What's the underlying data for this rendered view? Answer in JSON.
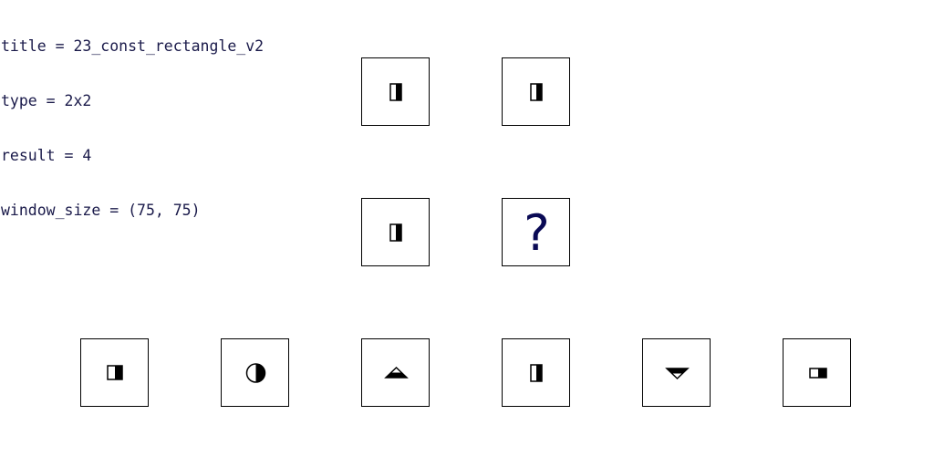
{
  "header": {
    "title_line": "title = 23_const_rectangle_v2",
    "type_line": "type = 2x2",
    "result_line": "result = 4",
    "window_line": "window_size = (75, 75)"
  },
  "matrix": {
    "cells": [
      {
        "shape": "half-filled-vertical-rect-icon",
        "fill_side": "right"
      },
      {
        "shape": "half-filled-vertical-rect-icon",
        "fill_side": "right"
      },
      {
        "shape": "half-filled-vertical-rect-icon",
        "fill_side": "right"
      },
      {
        "shape": "question-mark",
        "text": "?"
      }
    ]
  },
  "answers": [
    {
      "shape": "half-filled-square-icon",
      "fill_side": "right"
    },
    {
      "shape": "half-filled-circle-icon",
      "fill_side": "right"
    },
    {
      "shape": "half-filled-triangle-up-icon",
      "fill_side": "bottom"
    },
    {
      "shape": "half-filled-vertical-rect-icon",
      "fill_side": "right"
    },
    {
      "shape": "half-filled-triangle-down-icon",
      "fill_side": "top"
    },
    {
      "shape": "half-filled-horizontal-rect-icon",
      "fill_side": "right"
    }
  ],
  "colors": {
    "text": "#1a1a4a",
    "question_mark": "#0a0a55",
    "stroke": "#000000",
    "background": "#ffffff"
  }
}
